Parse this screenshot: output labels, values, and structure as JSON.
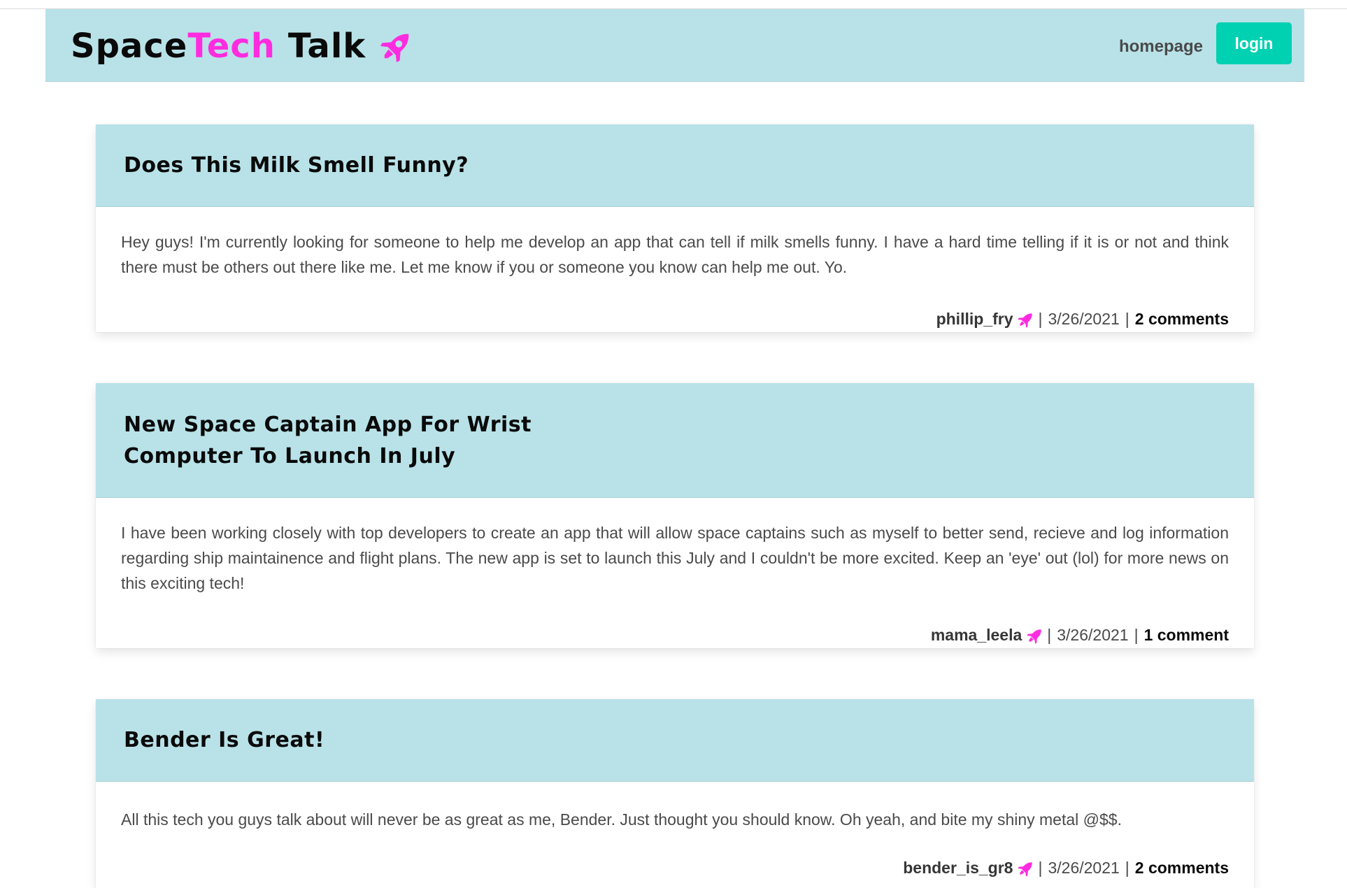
{
  "brand": {
    "part1": "Space",
    "part2": "Tech",
    "part3": "Talk",
    "accent_color": "#ff2cdf",
    "icon": "rocket-icon"
  },
  "nav": {
    "homepage_label": "homepage",
    "login_label": "login",
    "login_color": "#00d1b2"
  },
  "posts": [
    {
      "title": "Does This Milk Smell Funny?",
      "body": "Hey guys! I'm currently looking for someone to help me develop an app that can tell if milk smells funny. I have a hard time telling if it is or not and think there must be others out there like me. Let me know if you or someone you know can help me out. Yo.",
      "author": "phillip_fry",
      "date": "3/26/2021",
      "comments": "2 comments"
    },
    {
      "title": "New Space Captain App For Wrist Computer To Launch In July",
      "body": "I have been working closely with top developers to create an app that will allow space captains such as myself to better send, recieve and log information regarding ship maintainence and flight plans. The new app is set to launch this July and I couldn't be more excited. Keep an 'eye' out (lol) for more news on this exciting tech!",
      "author": "mama_leela",
      "date": "3/26/2021",
      "comments": "1 comment"
    },
    {
      "title": "Bender Is Great!",
      "body": "All this tech you guys talk about will never be as great as me, Bender. Just thought you should know. Oh yeah, and bite my shiny metal @$$.",
      "author": "bender_is_gr8",
      "date": "3/26/2021",
      "comments": "2 comments"
    }
  ],
  "meta_separator": "|"
}
